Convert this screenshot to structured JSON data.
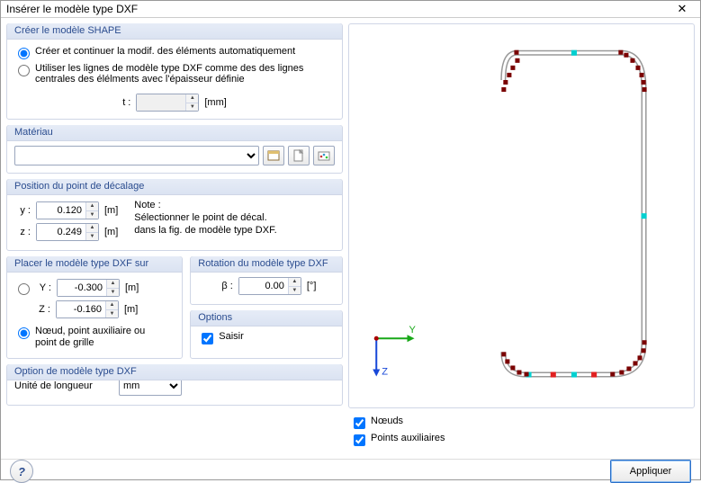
{
  "window": {
    "title": "Insérer le modèle type DXF"
  },
  "shape": {
    "title": "Créer le modèle SHAPE",
    "opt_auto": "Créer et continuer la modif. des éléments automatiquement",
    "opt_lines1": "Utiliser les lignes de modèle type DXF comme des des lignes",
    "opt_lines2": "centrales des élélments avec l'épaisseur définie",
    "t_label": "t :",
    "t_value": "",
    "t_unit": "[mm]"
  },
  "material": {
    "title": "Matériau",
    "value": ""
  },
  "offset": {
    "title": "Position du point de décalage",
    "y_label": "y :",
    "y_value": "0.120",
    "y_unit": "[m]",
    "z_label": "z :",
    "z_value": "0.249",
    "z_unit": "[m]",
    "note_label": "Note :",
    "note_line1": "Sélectionner le point de décal.",
    "note_line2": "dans la fig. de modèle type DXF."
  },
  "place": {
    "title": "Placer le modèle type DXF sur",
    "Y_label": "Y :",
    "Y_value": "-0.300",
    "Y_unit": "[m]",
    "Z_label": "Z :",
    "Z_value": "-0.160",
    "Z_unit": "[m]",
    "opt_node": "Nœud, point auxiliaire ou point de grille"
  },
  "rotation": {
    "title": "Rotation du modèle type DXF",
    "beta_label": "β :",
    "beta_value": "0.00",
    "beta_unit": "[°]"
  },
  "options": {
    "title": "Options",
    "snap": "Saisir"
  },
  "units": {
    "title": "Option de modèle type DXF",
    "label": "Unité de longueur",
    "value": "mm"
  },
  "preview": {
    "axis_y": "Y",
    "axis_z": "Z",
    "chk_nodes": "Nœuds",
    "chk_aux": "Points auxiliaires"
  },
  "footer": {
    "apply": "Appliquer"
  },
  "chart_data": {
    "type": "scatter",
    "title": "",
    "xlabel": "Y",
    "ylabel": "Z",
    "ylim": [
      0,
      370
    ],
    "xlim": [
      0,
      180
    ],
    "note": "Pixel-space approximation of DXF outline nodes shown in preview (origin top-left of drawing region, Y right, Z down).",
    "series": [
      {
        "name": "outline",
        "values_xy": [
          [
            35,
            10
          ],
          [
            150,
            10
          ],
          [
            155,
            12
          ],
          [
            162,
            18
          ],
          [
            168,
            26
          ],
          [
            172,
            34
          ],
          [
            174,
            42
          ],
          [
            175,
            50
          ],
          [
            175,
            330
          ],
          [
            174,
            338
          ],
          [
            170,
            346
          ],
          [
            165,
            352
          ],
          [
            158,
            358
          ],
          [
            150,
            362
          ],
          [
            140,
            365
          ],
          [
            45,
            365
          ],
          [
            38,
            363
          ],
          [
            30,
            358
          ],
          [
            24,
            350
          ],
          [
            20,
            342
          ],
          [
            20,
            50
          ],
          [
            22,
            42
          ],
          [
            26,
            34
          ],
          [
            30,
            26
          ],
          [
            35,
            18
          ],
          [
            35,
            10
          ]
        ]
      },
      {
        "name": "cyan-midpoints",
        "values_xy": [
          [
            98,
            10
          ],
          [
            175,
            190
          ],
          [
            98,
            365
          ],
          [
            48,
            365
          ]
        ]
      },
      {
        "name": "red-midpoints",
        "values_xy": [
          [
            75,
            365
          ],
          [
            120,
            365
          ]
        ]
      }
    ]
  }
}
